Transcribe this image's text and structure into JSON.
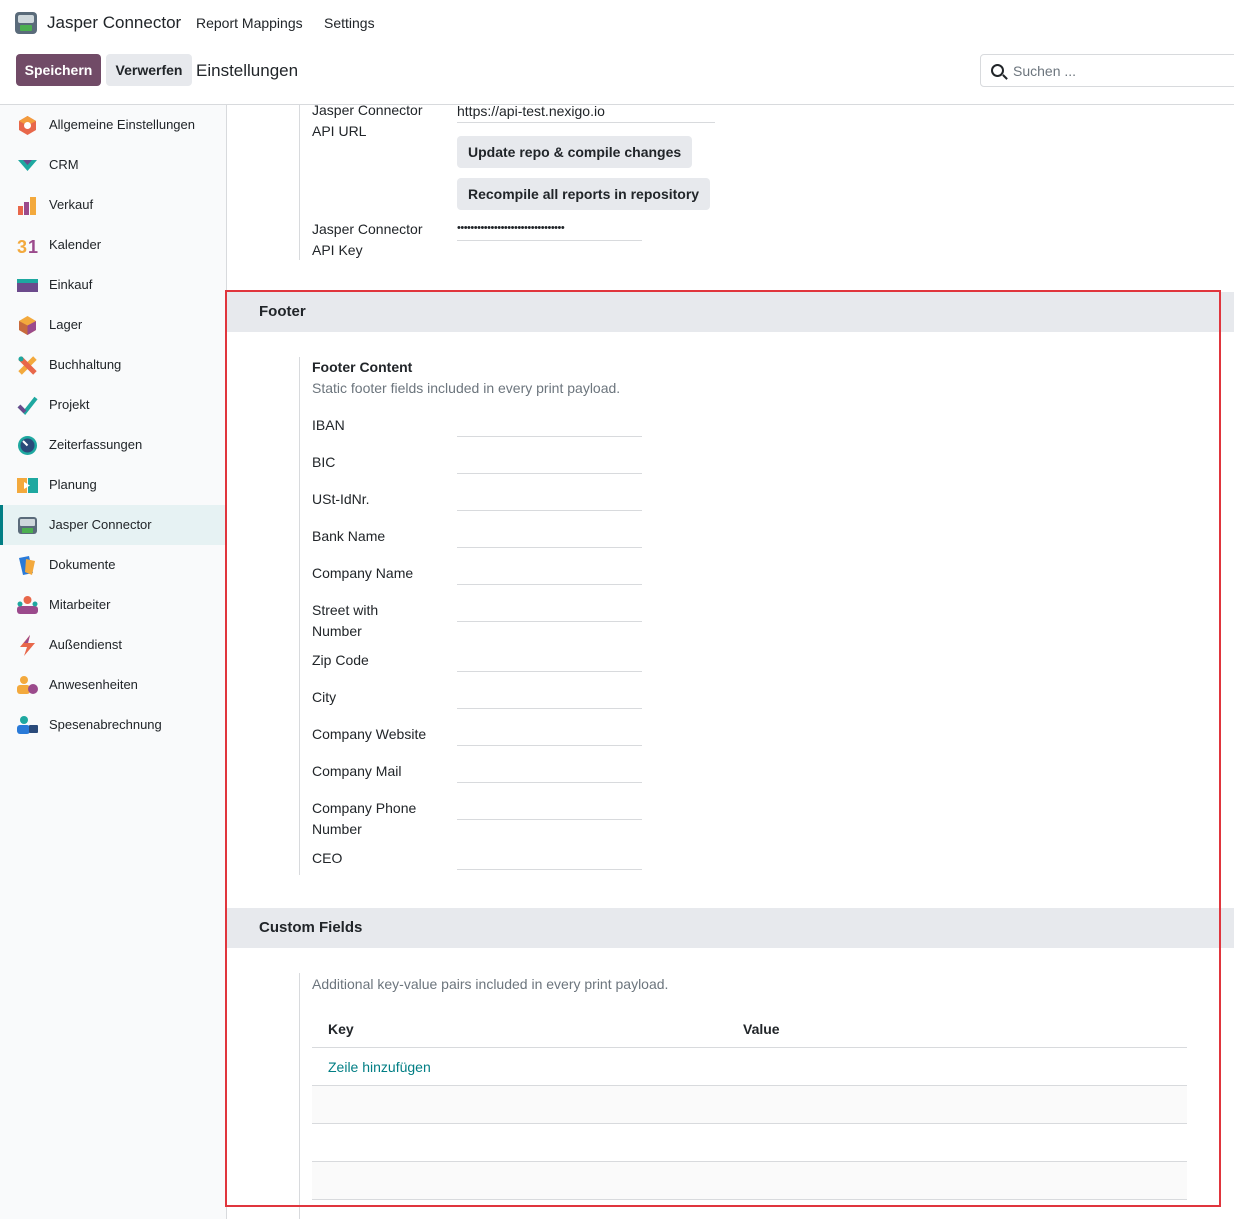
{
  "navbar": {
    "app_icon": "jasper-connector-app-icon",
    "app_title": "Jasper Connector",
    "menu": [
      "Report Mappings",
      "Settings"
    ]
  },
  "control_panel": {
    "save_label": "Speichern",
    "discard_label": "Verwerfen",
    "heading": "Einstellungen",
    "search_placeholder": "Suchen ...",
    "primary_color": "#714b67"
  },
  "sidebar": {
    "active_index": 10,
    "items": [
      {
        "label": "Allgemeine Einstellungen",
        "icon": "general-settings-icon"
      },
      {
        "label": "CRM",
        "icon": "crm-icon"
      },
      {
        "label": "Verkauf",
        "icon": "sales-icon"
      },
      {
        "label": "Kalender",
        "icon": "calendar-icon"
      },
      {
        "label": "Einkauf",
        "icon": "purchase-icon"
      },
      {
        "label": "Lager",
        "icon": "inventory-icon"
      },
      {
        "label": "Buchhaltung",
        "icon": "accounting-icon"
      },
      {
        "label": "Projekt",
        "icon": "project-icon"
      },
      {
        "label": "Zeiterfassungen",
        "icon": "timesheet-icon"
      },
      {
        "label": "Planung",
        "icon": "planning-icon"
      },
      {
        "label": "Jasper Connector",
        "icon": "jasper-connector-icon"
      },
      {
        "label": "Dokumente",
        "icon": "documents-icon"
      },
      {
        "label": "Mitarbeiter",
        "icon": "employees-icon"
      },
      {
        "label": "Außendienst",
        "icon": "field-service-icon"
      },
      {
        "label": "Anwesenheiten",
        "icon": "attendances-icon"
      },
      {
        "label": "Spesenabrechnung",
        "icon": "expenses-icon"
      }
    ]
  },
  "api": {
    "url_label_1": "Jasper Connector",
    "url_label_2": "API URL",
    "url_value": "https://api-test.nexigo.io",
    "update_button": "Update repo & compile changes",
    "recompile_button": "Recompile all reports in repository",
    "key_label_1": "Jasper Connector",
    "key_label_2": "API Key",
    "key_value": "••••••••••••••••••••••••••••••••"
  },
  "footer_section": {
    "title": "Footer",
    "content_title": "Footer Content",
    "content_help": "Static footer fields included in every print payload.",
    "fields": [
      {
        "label": "IBAN",
        "value": ""
      },
      {
        "label": "BIC",
        "value": ""
      },
      {
        "label": "USt-IdNr.",
        "value": ""
      },
      {
        "label": "Bank Name",
        "value": ""
      },
      {
        "label": "Company Name",
        "value": ""
      },
      {
        "label": "Street with",
        "label2": "Number",
        "value": ""
      },
      {
        "label": "Zip Code",
        "value": ""
      },
      {
        "label": "City",
        "value": ""
      },
      {
        "label": "Company Website",
        "value": ""
      },
      {
        "label": "Company Mail",
        "value": ""
      },
      {
        "label": "Company Phone",
        "label2": "Number",
        "value": ""
      },
      {
        "label": "CEO",
        "value": ""
      }
    ]
  },
  "custom_fields_section": {
    "title": "Custom Fields",
    "help": "Additional key-value pairs included in every print payload.",
    "columns": [
      "Key",
      "Value"
    ],
    "add_row_label": "Zeile hinzufügen",
    "rows": []
  },
  "highlight_color": "#e0353d"
}
